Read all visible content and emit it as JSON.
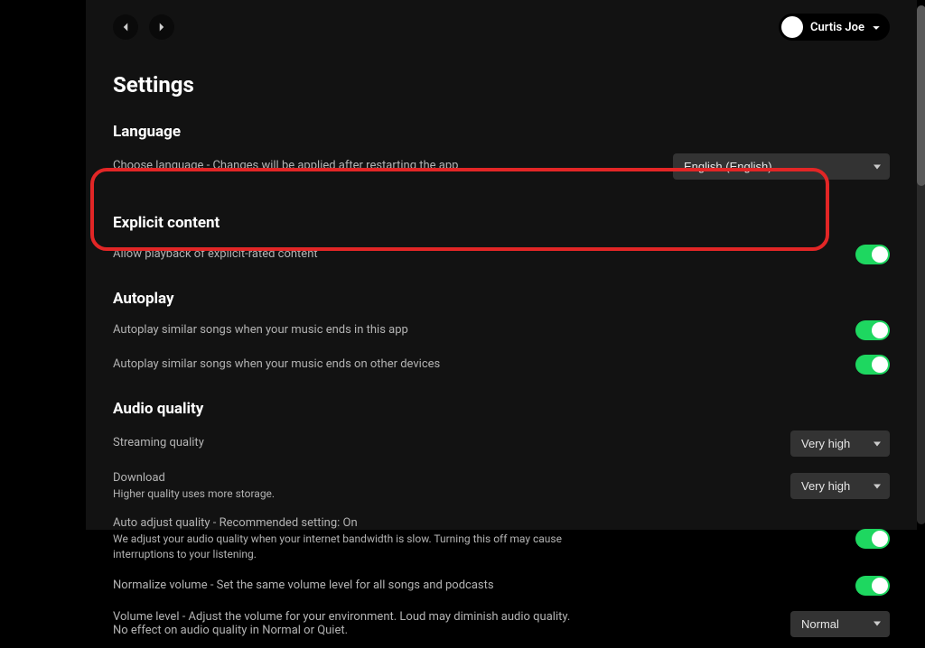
{
  "user": {
    "name": "Curtis Joe"
  },
  "page": {
    "title": "Settings"
  },
  "language": {
    "heading": "Language",
    "description": "Choose language - Changes will be applied after restarting the app",
    "selected": "English (English)"
  },
  "explicit": {
    "heading": "Explicit content",
    "description": "Allow playback of explicit-rated content",
    "enabled": true
  },
  "autoplay": {
    "heading": "Autoplay",
    "row1": "Autoplay similar songs when your music ends in this app",
    "row2": "Autoplay similar songs when your music ends on other devices",
    "r1_enabled": true,
    "r2_enabled": true
  },
  "audio": {
    "heading": "Audio quality",
    "streaming_label": "Streaming quality",
    "streaming_value": "Very high",
    "download_label": "Download",
    "download_sub": "Higher quality uses more storage.",
    "download_value": "Very high",
    "autoadjust_label": "Auto adjust quality - Recommended setting: On",
    "autoadjust_sub": "We adjust your audio quality when your internet bandwidth is slow. Turning this off may cause interruptions to your listening.",
    "autoadjust_enabled": true,
    "normalize_label": "Normalize volume - Set the same volume level for all songs and podcasts",
    "normalize_enabled": true,
    "volumelevel_label": "Volume level - Adjust the volume for your environment. Loud may diminish audio quality. No effect on audio quality in Normal or Quiet.",
    "volumelevel_value": "Normal"
  }
}
